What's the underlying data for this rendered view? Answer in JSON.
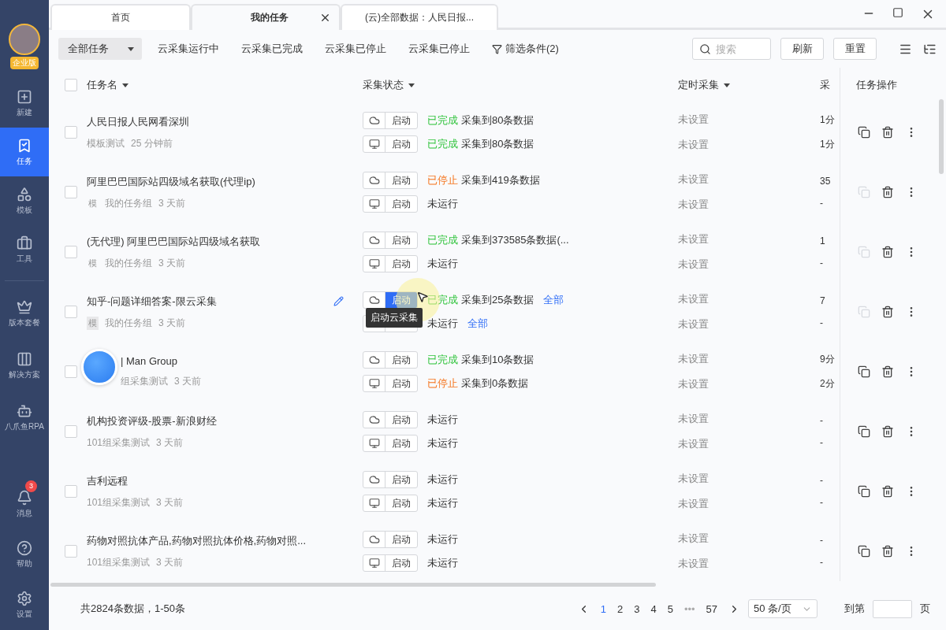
{
  "sidebar": {
    "badge": "企业版",
    "primary": [
      {
        "label": "新建",
        "selected": false
      },
      {
        "label": "任务",
        "selected": true
      },
      {
        "label": "模板",
        "selected": false
      },
      {
        "label": "工具",
        "selected": false
      }
    ],
    "secondary": [
      {
        "label": "版本套餐",
        "selected": false
      },
      {
        "label": "解决方案",
        "selected": false
      },
      {
        "label": "八爪鱼RPA",
        "selected": false
      }
    ],
    "bottom": [
      {
        "label": "消息",
        "selected": false,
        "count": "3"
      },
      {
        "label": "帮助",
        "selected": false
      },
      {
        "label": "设置",
        "selected": false
      }
    ]
  },
  "tabs": [
    {
      "label": "首页",
      "selected": false,
      "closable": false
    },
    {
      "label": "我的任务",
      "selected": true,
      "closable": true
    },
    {
      "label": "(云)全部数据：人民日报...",
      "selected": false,
      "closable": false
    }
  ],
  "toolbar": {
    "dropdown": "全部任务",
    "filters": [
      "云采集运行中",
      "云采集已完成",
      "云采集已停止",
      "云采集已停止"
    ],
    "conditions": "筛选条件(2)",
    "search": {
      "placeholder": "搜索"
    },
    "buttons": [
      "刷新",
      "重置"
    ]
  },
  "table": {
    "select_all": {
      "checked": false
    },
    "columns": [
      {
        "label": "任务名",
        "sort": true
      },
      {
        "label": "采集状态",
        "sort": true
      },
      {
        "label": "定时采集",
        "sort": true
      },
      {
        "label": "采",
        "sort": false
      }
    ],
    "actions_header": "任务操作",
    "rows": [
      {
        "name": "人民日报人民网看深圳",
        "group": "模板测试",
        "time": "25 分钟前",
        "checked": false,
        "copy_disabled": false,
        "schedule": [
          "未设置",
          "未设置"
        ],
        "column_4": [
          "1分",
          "1分"
        ],
        "lines": [
          {
            "button": "启动",
            "status": "已完成",
            "kind": "done",
            "detail": "采集到80条数据",
            "hovered": false
          },
          {
            "button": "启动",
            "status": "已完成",
            "kind": "done",
            "detail": "采集到80条数据",
            "hovered": false
          }
        ]
      },
      {
        "name": "阿里巴巴国际站四级域名获取(代理ip)",
        "tag": "模",
        "group": "我的任务组",
        "time": "3 天前",
        "checked": false,
        "copy_disabled": true,
        "schedule": [
          "未设置",
          "未设置"
        ],
        "column_4": [
          "35",
          "-"
        ],
        "lines": [
          {
            "button": "启动",
            "status": "已停止",
            "kind": "stopped",
            "detail": "采集到419条数据",
            "hovered": false
          },
          {
            "button": "启动",
            "status": "未运行",
            "kind": "idle",
            "hovered": false
          }
        ]
      },
      {
        "name": "(无代理) 阿里巴巴国际站四级域名获取",
        "tag": "模",
        "group": "我的任务组",
        "time": "3 天前",
        "checked": false,
        "copy_disabled": true,
        "schedule": [
          "未设置",
          "未设置"
        ],
        "column_4": [
          "1",
          "-"
        ],
        "lines": [
          {
            "button": "启动",
            "status": "已完成",
            "kind": "done",
            "detail": "采集到373585条数据(...",
            "hovered": false
          },
          {
            "button": "启动",
            "status": "未运行",
            "kind": "idle",
            "hovered": false
          }
        ]
      },
      {
        "name": "知乎-问题详细答案-限云采集",
        "tag": "模",
        "tag_highlighted": true,
        "editable": true,
        "group": "我的任务组",
        "time": "3 天前",
        "checked": false,
        "copy_disabled": true,
        "schedule": [
          "未设置",
          "未设置"
        ],
        "column_4": [
          "7",
          "-"
        ],
        "lines": [
          {
            "button": "启动",
            "status": "已完成",
            "kind": "done",
            "detail": "采集到25条数据",
            "link": "全部",
            "hovered": true,
            "tooltip": "启动云采集"
          },
          {
            "status": "未运行",
            "kind": "idle",
            "link": "全部"
          }
        ]
      },
      {
        "name": "| Man Group",
        "overlay": true,
        "group": "组采集测试",
        "time": "3 天前",
        "checked": false,
        "copy_disabled": false,
        "schedule": [
          "未设置",
          "未设置"
        ],
        "column_4": [
          "9分",
          "2分"
        ],
        "lines": [
          {
            "button": "启动",
            "status": "已完成",
            "kind": "done",
            "detail": "采集到10条数据",
            "hovered": false
          },
          {
            "button": "启动",
            "status": "已停止",
            "kind": "stopped",
            "detail": "采集到0条数据",
            "hovered": false
          }
        ]
      },
      {
        "name": "机构投资评级-股票-新浪财经",
        "group": "101组采集测试",
        "time": "3 天前",
        "checked": false,
        "copy_disabled": false,
        "schedule": [
          "未设置",
          "未设置"
        ],
        "column_4": [
          "-",
          "-"
        ],
        "lines": [
          {
            "button": "启动",
            "status": "未运行",
            "kind": "idle",
            "hovered": false
          },
          {
            "button": "启动",
            "status": "未运行",
            "kind": "idle",
            "hovered": false
          }
        ]
      },
      {
        "name": "吉利远程",
        "group": "101组采集测试",
        "time": "3 天前",
        "checked": false,
        "copy_disabled": false,
        "schedule": [
          "未设置",
          "未设置"
        ],
        "column_4": [
          "-",
          "-"
        ],
        "lines": [
          {
            "button": "启动",
            "status": "未运行",
            "kind": "idle",
            "hovered": false
          },
          {
            "button": "启动",
            "status": "未运行",
            "kind": "idle",
            "hovered": false
          }
        ]
      },
      {
        "name": "药物对照抗体产品,药物对照抗体价格,药物对照...",
        "group": "101组采集测试",
        "time": "3 天前",
        "checked": false,
        "copy_disabled": false,
        "schedule": [
          "未设置",
          "未设置"
        ],
        "column_4": [
          "-",
          "-"
        ],
        "lines": [
          {
            "button": "启动",
            "status": "未运行",
            "kind": "idle",
            "hovered": false
          },
          {
            "button": "启动",
            "status": "未运行",
            "kind": "idle",
            "hovered": false
          }
        ]
      }
    ]
  },
  "footer": {
    "summary": "共2824条数据，1-50条",
    "pages": [
      {
        "label": "1",
        "selected": true
      },
      {
        "label": "2",
        "selected": false
      },
      {
        "label": "3",
        "selected": false
      },
      {
        "label": "4",
        "selected": false
      },
      {
        "label": "5",
        "selected": false
      },
      {
        "label": "•••",
        "selected": false
      },
      {
        "label": "57",
        "selected": false
      }
    ],
    "page_size": "50 条/页",
    "jump_label": "到第",
    "jump_suffix": "页"
  }
}
